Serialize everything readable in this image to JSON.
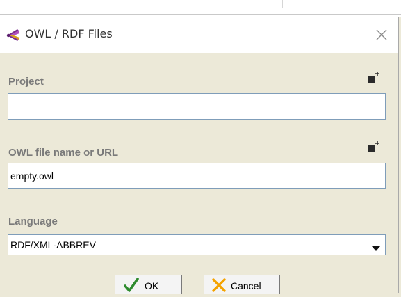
{
  "dialog": {
    "title": "OWL / RDF Files",
    "title_icon": "owl-rdf-icon",
    "close_icon": "close-icon"
  },
  "form": {
    "project": {
      "label": "Project",
      "value": "",
      "add_icon": "add-icon"
    },
    "owl_file": {
      "label": "OWL file name or URL",
      "value": "empty.owl",
      "add_icon": "add-icon"
    },
    "language": {
      "label": "Language",
      "selected": "RDF/XML-ABBREV",
      "dropdown_icon": "chevron-down-icon"
    }
  },
  "buttons": {
    "ok_label": "OK",
    "ok_icon": "checkmark-icon",
    "cancel_label": "Cancel",
    "cancel_icon": "cross-icon"
  },
  "colors": {
    "dialog_background": "#ece9d8",
    "label_text": "#7a7a7a",
    "input_border": "#7f9db9",
    "ok_check": "#2e8b2e",
    "cancel_cross": "#f4a300"
  }
}
